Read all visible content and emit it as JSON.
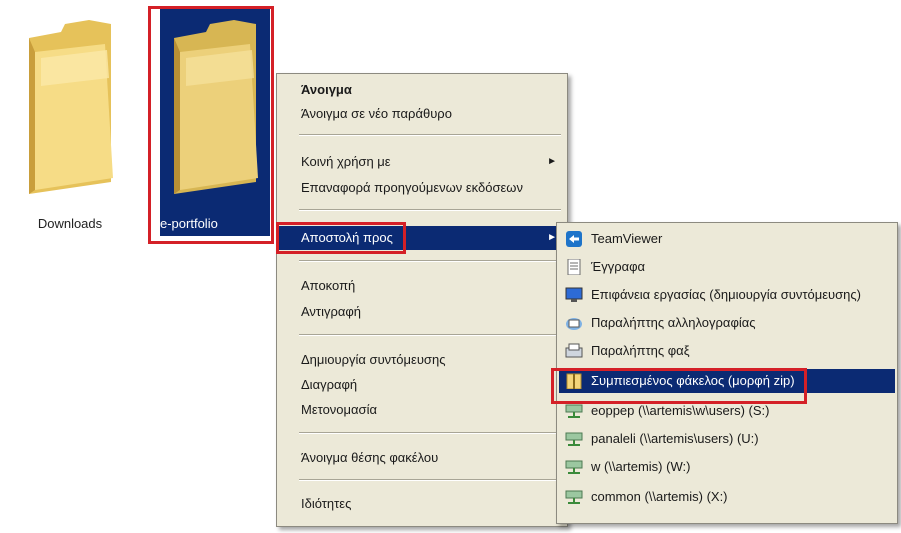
{
  "desktop": {
    "items": [
      {
        "label": "Downloads"
      },
      {
        "label": "e-portfolio"
      }
    ]
  },
  "context_menu": {
    "items": [
      {
        "label": "Άνοιγμα"
      },
      {
        "label": "Άνοιγμα σε νέο παράθυρο"
      },
      {
        "label": "Κοινή χρήση με"
      },
      {
        "label": "Επαναφορά προηγούμενων εκδόσεων"
      },
      {
        "label": "Αποστολή προς"
      },
      {
        "label": "Αποκοπή"
      },
      {
        "label": "Αντιγραφή"
      },
      {
        "label": "Δημιουργία συντόμευσης"
      },
      {
        "label": "Διαγραφή"
      },
      {
        "label": "Μετονομασία"
      },
      {
        "label": "Άνοιγμα θέσης φακέλου"
      },
      {
        "label": "Ιδιότητες"
      }
    ],
    "submenu_arrow": "►"
  },
  "send_to_menu": {
    "items": [
      {
        "label": "TeamViewer",
        "icon": "teamviewer-icon"
      },
      {
        "label": "Έγγραφα",
        "icon": "documents-icon"
      },
      {
        "label": "Επιφάνεια εργασίας (δημιουργία συντόμευσης)",
        "icon": "desktop-icon"
      },
      {
        "label": "Παραλήπτης αλληλογραφίας",
        "icon": "mail-recipient-icon"
      },
      {
        "label": "Παραλήπτης φαξ",
        "icon": "fax-recipient-icon"
      },
      {
        "label": "Συμπιεσμένος φάκελος (μορφή zip)",
        "icon": "zip-folder-icon"
      },
      {
        "label": "eoppep (\\\\artemis\\w\\users) (S:)",
        "icon": "network-drive-icon"
      },
      {
        "label": "panaleli (\\\\artemis\\users) (U:)",
        "icon": "network-drive-icon"
      },
      {
        "label": "w (\\\\artemis) (W:)",
        "icon": "network-drive-icon"
      },
      {
        "label": "common (\\\\artemis) (X:)",
        "icon": "network-drive-icon"
      }
    ]
  },
  "colors": {
    "highlight": "#0b2a73",
    "menu_bg": "#ece9d8",
    "annotation_red": "#d42027",
    "folder_yellow": "#f3d57a"
  }
}
